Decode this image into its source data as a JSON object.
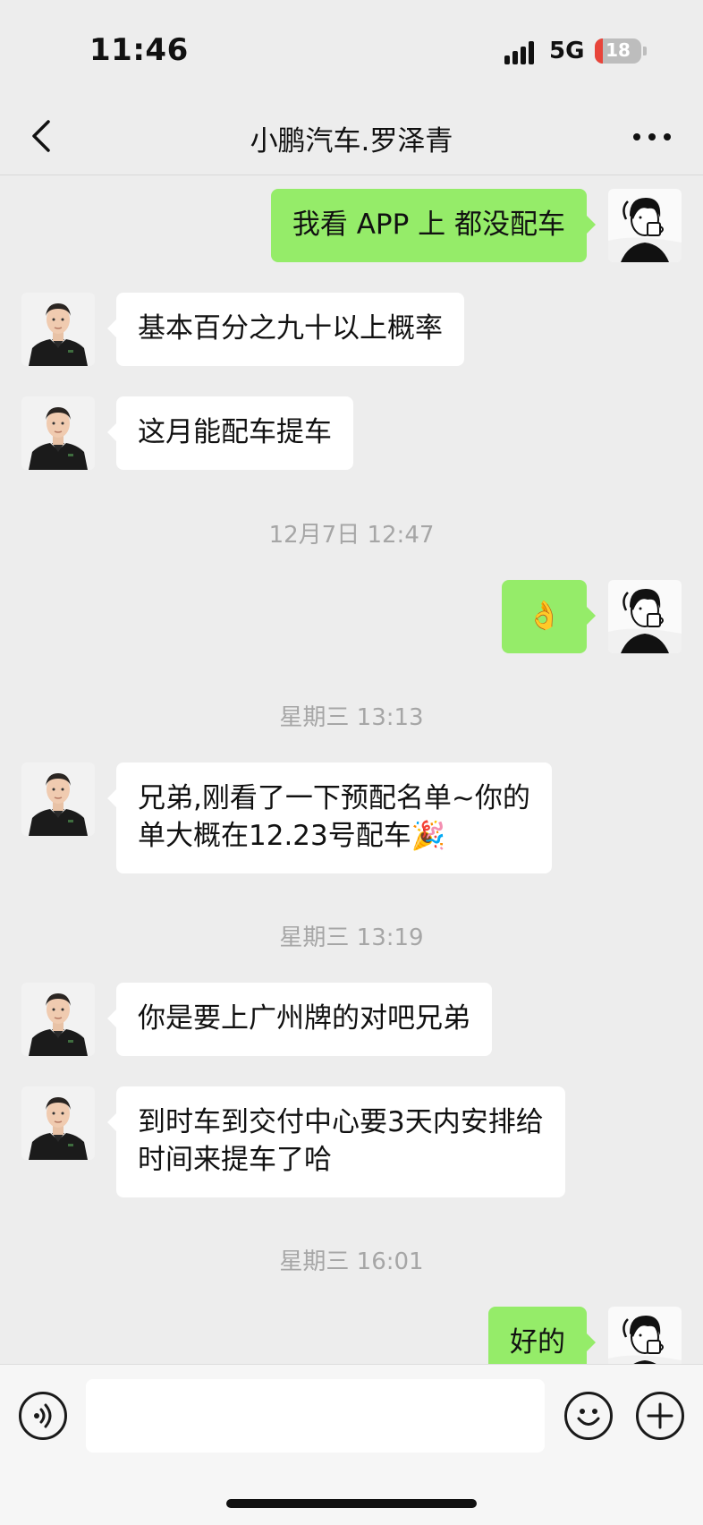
{
  "status_bar": {
    "time": "11:46",
    "network": "5G",
    "battery": "18",
    "battery_level": 0.18
  },
  "header": {
    "back_icon": "chevron-left-icon",
    "title": "小鹏汽车.罗泽青",
    "more_icon": "more-horizontal-icon"
  },
  "chat": {
    "msg1": {
      "side": "out",
      "text": "我看 APP 上 都没配车"
    },
    "msg2": {
      "side": "in",
      "text": "基本百分之九十以上概率"
    },
    "msg3": {
      "side": "in",
      "text": "这月能配车提车"
    },
    "ts1": "12月7日 12:47",
    "msg4": {
      "side": "out",
      "text": "👌"
    },
    "ts2": "星期三 13:13",
    "msg5": {
      "side": "in",
      "line1": "兄弟,刚看了一下预配名单~你的",
      "line2": "单大概在12.23号配车🎉"
    },
    "ts3": "星期三 13:19",
    "msg6": {
      "side": "in",
      "text": "你是要上广州牌的对吧兄弟"
    },
    "msg7": {
      "side": "in",
      "line1": "到时车到交付中心要3天内安排给",
      "line2": "时间来提车了哈"
    },
    "ts4": "星期三 16:01",
    "msg8": {
      "side": "out",
      "text": "好的"
    }
  },
  "input_bar": {
    "voice_icon": "voice-icon",
    "emoji_icon": "emoji-icon",
    "plus_icon": "plus-icon"
  },
  "colors": {
    "background": "#ededed",
    "outgoing_bubble": "#95ec69",
    "incoming_bubble": "#ffffff",
    "timestamp": "#a6a6a6",
    "battery_low": "#e8443a"
  }
}
